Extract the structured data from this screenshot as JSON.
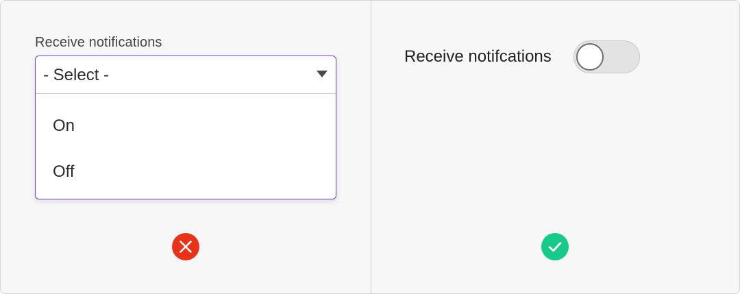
{
  "left_example": {
    "label": "Receive notifications",
    "select": {
      "value": "- Select -",
      "options": [
        "On",
        "Off"
      ]
    },
    "verdict_icon": "cross-circle-icon",
    "verdict_color": "#e8321a"
  },
  "right_example": {
    "label": "Receive notifcations",
    "toggle_state": "off",
    "verdict_icon": "check-circle-icon",
    "verdict_color": "#17c98a"
  },
  "colors": {
    "focus_border": "#7b3fd1",
    "background": "#f7f7f7"
  }
}
